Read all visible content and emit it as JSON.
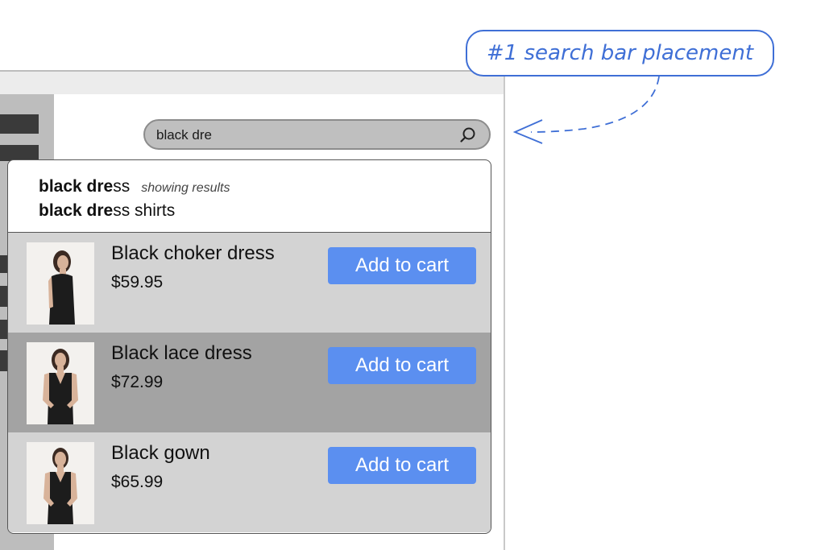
{
  "callout": {
    "label": "#1 search bar placement",
    "color": "#3f6fd6"
  },
  "search": {
    "value": "black dre",
    "icon": "search-icon"
  },
  "suggestions": [
    {
      "bold": "black dre",
      "rest": "ss",
      "hint": "showing results"
    },
    {
      "bold": "black dre",
      "rest": "ss shirts",
      "hint": ""
    }
  ],
  "results": [
    {
      "name": "Black choker dress",
      "price": "$59.95",
      "button": "Add to cart"
    },
    {
      "name": "Black lace dress",
      "price": "$72.99",
      "button": "Add to cart"
    },
    {
      "name": "Black gown",
      "price": "$65.99",
      "button": "Add to cart"
    }
  ],
  "colors": {
    "accent": "#5b8ff0",
    "highlight_row": "#a3a3a3",
    "row": "#d3d3d3"
  }
}
